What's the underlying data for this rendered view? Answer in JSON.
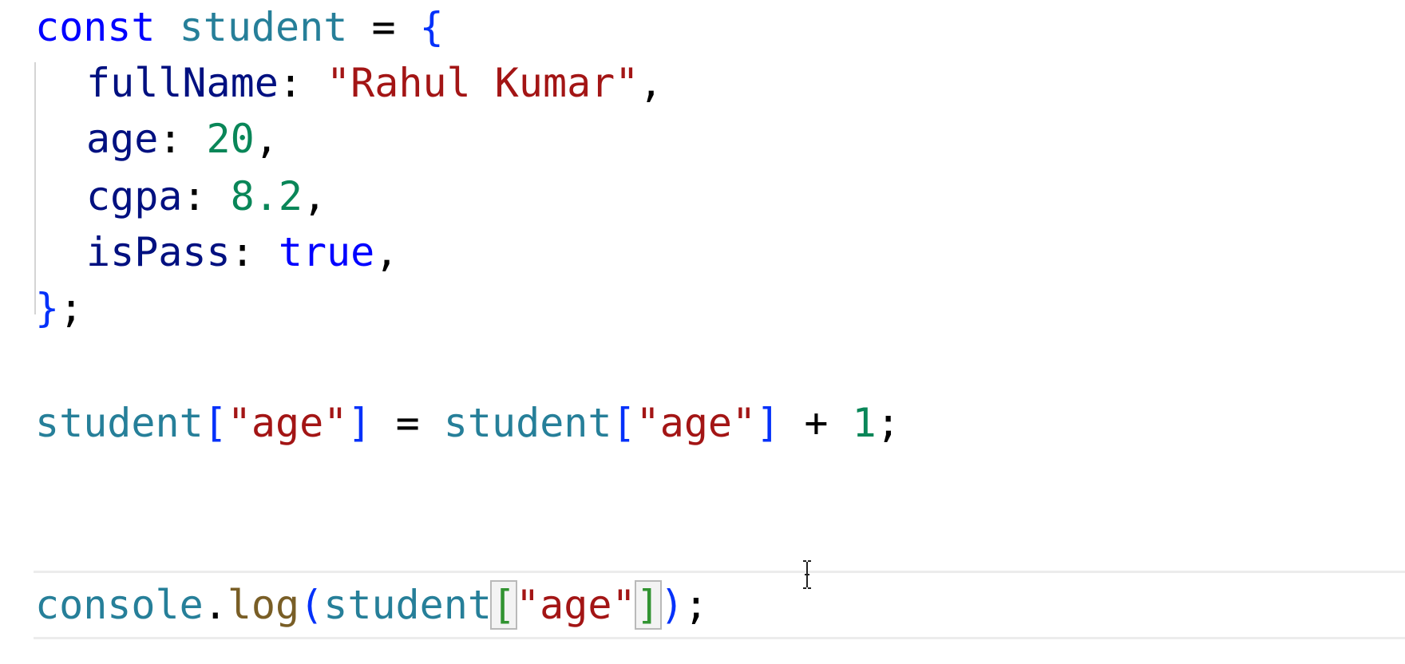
{
  "code": {
    "l1": {
      "kw": "const",
      "var": "student",
      "op": "=",
      "brace": "{"
    },
    "l2": {
      "prop": "fullName",
      "colon": ":",
      "str": "\"Rahul Kumar\"",
      "comma": ","
    },
    "l3": {
      "prop": "age",
      "colon": ":",
      "num": "20",
      "comma": ","
    },
    "l4": {
      "prop": "cgpa",
      "colon": ":",
      "num": "8.2",
      "comma": ","
    },
    "l5": {
      "prop": "isPass",
      "colon": ":",
      "kw": "true",
      "comma": ","
    },
    "l6": {
      "brace": "}",
      "semi": ";"
    },
    "l8": {
      "var1": "student",
      "open1": "[",
      "str1": "\"age\"",
      "close1": "]",
      "op": "=",
      "var2": "student",
      "open2": "[",
      "str2": "\"age\"",
      "close2": "]",
      "plus": "+",
      "num": "1",
      "semi": ";"
    },
    "l10": {
      "obj": "console",
      "dot": ".",
      "fn": "log",
      "paren_open": "(",
      "var": "student",
      "bracket_open": "[",
      "str": "\"age\"",
      "bracket_close": "]",
      "paren_close": ")",
      "semi": ";"
    }
  },
  "colors": {
    "keyword": "#0000ff",
    "variable": "#267f99",
    "property": "#001080",
    "string": "#a31515",
    "number": "#098658",
    "function": "#795e26"
  },
  "icons": {
    "cursor": "text-cursor-icon"
  }
}
